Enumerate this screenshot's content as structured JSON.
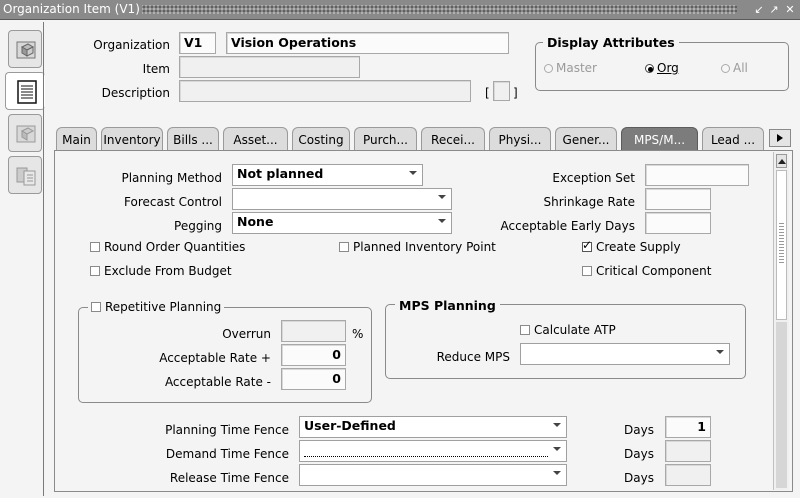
{
  "window": {
    "title": "Organization Item (V1)",
    "controls": [
      "minimize-icon",
      "maximize-icon",
      "close-icon"
    ]
  },
  "header": {
    "organization_label": "Organization",
    "organization_code": "V1",
    "organization_name": "Vision Operations",
    "item_label": "Item",
    "item_value": "",
    "description_label": "Description",
    "description_value": "",
    "bracket_open": "[",
    "bracket_close": "]"
  },
  "display_attributes": {
    "title": "Display Attributes",
    "options": [
      {
        "label": "Master",
        "selected": false,
        "enabled": false
      },
      {
        "label": "Org",
        "selected": true,
        "enabled": true
      },
      {
        "label": "All",
        "selected": false,
        "enabled": false
      }
    ]
  },
  "tabs": [
    {
      "label": "Main",
      "active": false
    },
    {
      "label": "Inventory",
      "active": false
    },
    {
      "label": "Bills ...",
      "active": false
    },
    {
      "label": "Asset...",
      "active": false
    },
    {
      "label": "Costing",
      "active": false
    },
    {
      "label": "Purch...",
      "active": false
    },
    {
      "label": "Recei...",
      "active": false
    },
    {
      "label": "Physi...",
      "active": false
    },
    {
      "label": "Gener...",
      "active": false
    },
    {
      "label": "MPS/M...",
      "active": true
    },
    {
      "label": "Lead ...",
      "active": false
    }
  ],
  "form": {
    "planning_method_label": "Planning Method",
    "planning_method_value": "Not planned",
    "forecast_control_label": "Forecast Control",
    "forecast_control_value": "",
    "pegging_label": "Pegging",
    "pegging_value": "None",
    "exception_set_label": "Exception Set",
    "exception_set_value": "",
    "shrinkage_rate_label": "Shrinkage Rate",
    "shrinkage_rate_value": "",
    "acceptable_early_days_label": "Acceptable Early Days",
    "acceptable_early_days_value": "",
    "round_order_quantities": {
      "label": "Round Order Quantities",
      "checked": false
    },
    "planned_inventory_point": {
      "label": "Planned Inventory Point",
      "checked": false
    },
    "create_supply": {
      "label": "Create Supply",
      "checked": true
    },
    "exclude_from_budget": {
      "label": "Exclude From Budget",
      "checked": false
    },
    "critical_component": {
      "label": "Critical Component",
      "checked": false
    }
  },
  "repetitive_planning": {
    "label": "Repetitive Planning",
    "checked": false,
    "overrun_label": "Overrun",
    "overrun_value": "",
    "percent": "%",
    "rate_plus_label": "Acceptable Rate +",
    "rate_plus_value": "0",
    "rate_minus_label": "Acceptable Rate -",
    "rate_minus_value": "0"
  },
  "mps_planning": {
    "title": "MPS Planning",
    "calculate_atp": {
      "label": "Calculate ATP",
      "checked": false
    },
    "reduce_mps_label": "Reduce MPS",
    "reduce_mps_value": ""
  },
  "time_fences": {
    "planning_label": "Planning Time Fence",
    "planning_value": "User-Defined",
    "planning_days": "1",
    "demand_label": "Demand Time Fence",
    "demand_value": "",
    "demand_days": "",
    "release_label": "Release Time Fence",
    "release_value": "",
    "release_days": "",
    "days_label": "Days"
  },
  "side_toolbar": [
    "open-folder-icon",
    "list-icon",
    "copy-folder-icon",
    "item-list-icon"
  ],
  "colors": {
    "title_bar": "#8a8a8a",
    "active_tab": "#7c7c7c",
    "background": "#f4f4f4"
  }
}
